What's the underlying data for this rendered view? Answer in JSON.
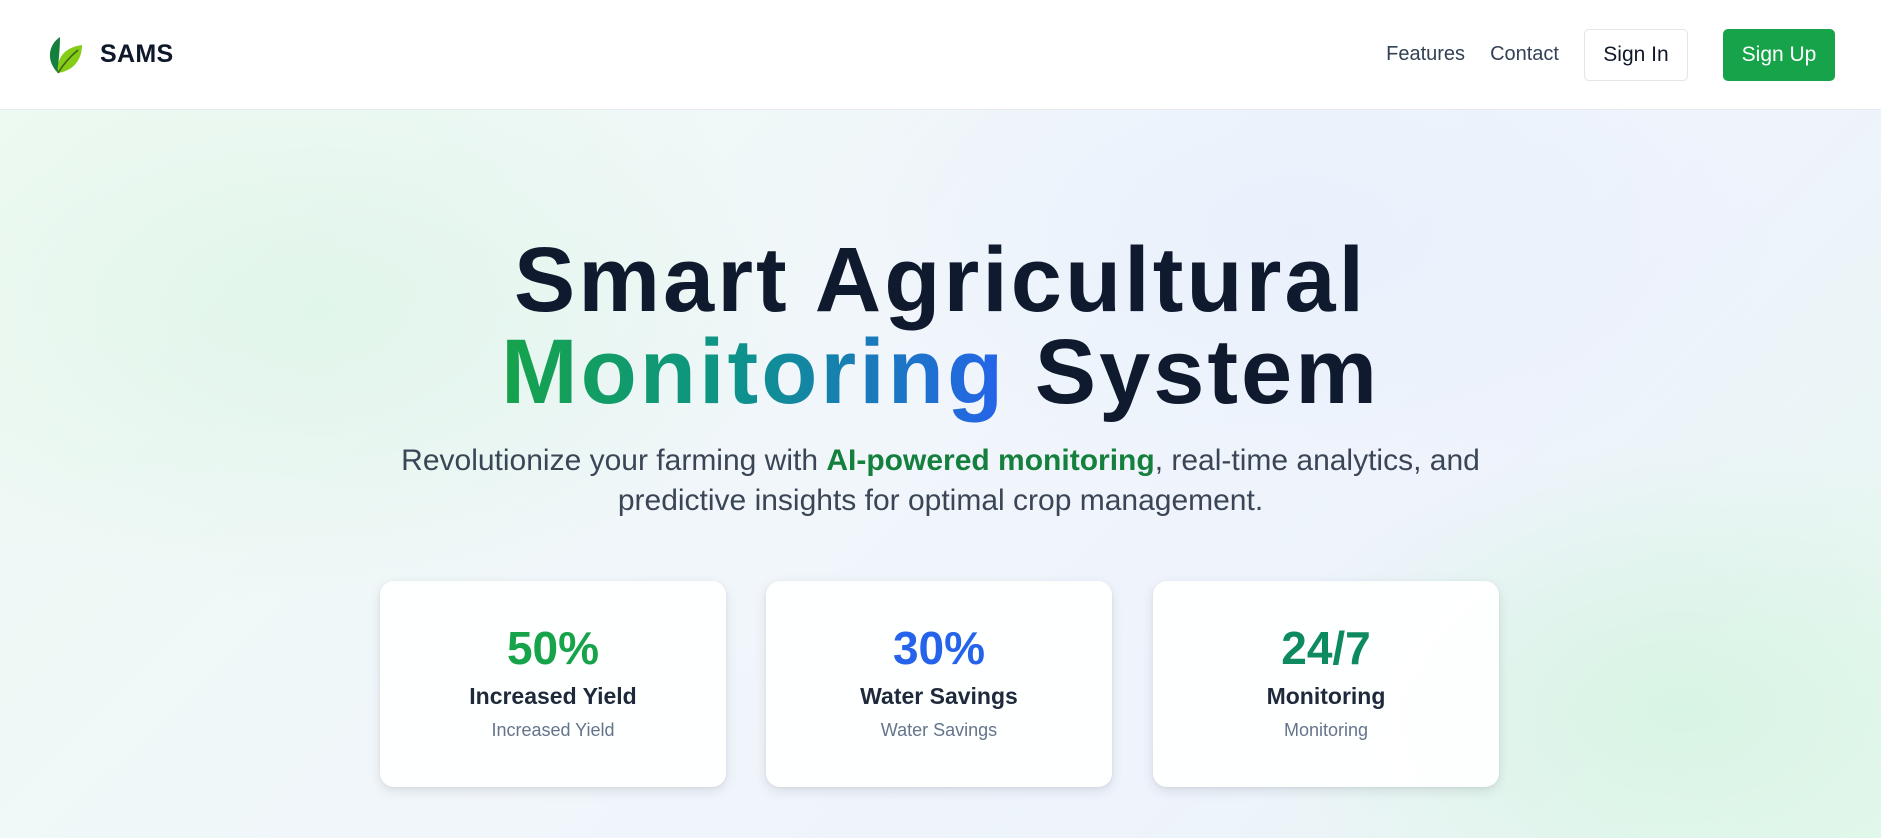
{
  "header": {
    "brand_name": "SAMS",
    "logo_icon": "leaf-logo-icon",
    "nav": {
      "features": "Features",
      "contact": "Contact",
      "sign_in": "Sign In",
      "sign_up": "Sign Up"
    }
  },
  "hero": {
    "title_line1": "Smart Agricultural",
    "title_gradient_word": "Monitoring",
    "title_line2_rest": " System",
    "subtitle_before": "Revolutionize your farming with ",
    "subtitle_highlight": "AI-powered monitoring",
    "subtitle_after": ", real-time analytics, and predictive insights for optimal crop management."
  },
  "stats": [
    {
      "value": "50%",
      "label": "Increased Yield",
      "sublabel": "Increased Yield",
      "color": "#16a34a"
    },
    {
      "value": "30%",
      "label": "Water Savings",
      "sublabel": "Water Savings",
      "color": "#2563eb"
    },
    {
      "value": "24/7",
      "label": "Monitoring",
      "sublabel": "Monitoring",
      "color": "#0d8a5f"
    }
  ],
  "colors": {
    "brand_green": "#16a34a",
    "highlight_green": "#15803d",
    "title_dark": "#0f1a2e",
    "gradient_start": "#16a34a",
    "gradient_end": "#2563eb"
  }
}
